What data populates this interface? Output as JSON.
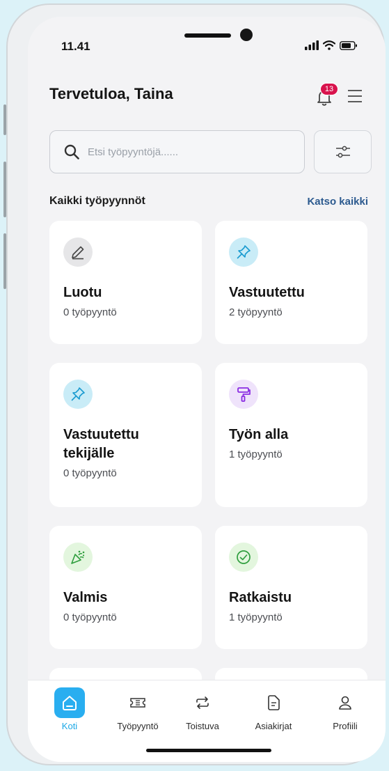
{
  "status_bar": {
    "time": "11.41"
  },
  "header": {
    "greeting": "Tervetuloa, Taina",
    "notification_count": "13"
  },
  "search": {
    "placeholder": "Etsi työpyyntöjä......"
  },
  "section": {
    "title": "Kaikki työpyynnöt",
    "link": "Katso kaikki"
  },
  "cards": [
    {
      "title": "Luotu",
      "count": "0 työpyyntö",
      "icon": "pencil-icon",
      "icon_bg": "#e6e6e8"
    },
    {
      "title": "Vastuutettu",
      "count": "2 työpyyntö",
      "icon": "pin-icon",
      "icon_bg": "#c9ecf7"
    },
    {
      "title": "Vastuutettu tekijälle",
      "count": "0 työpyyntö",
      "icon": "pin-icon",
      "icon_bg": "#c9ecf7"
    },
    {
      "title": "Työn alla",
      "count": "1 työpyyntö",
      "icon": "paint-roller-icon",
      "icon_bg": "#efe3fb"
    },
    {
      "title": "Valmis",
      "count": "0 työpyyntö",
      "icon": "party-popper-icon",
      "icon_bg": "#e3f6de"
    },
    {
      "title": "Ratkaistu",
      "count": "1 työpyyntö",
      "icon": "check-circle-icon",
      "icon_bg": "#e3f6de"
    }
  ],
  "nav": [
    {
      "label": "Koti",
      "icon": "home-icon",
      "active": true
    },
    {
      "label": "Työpyyntö",
      "icon": "ticket-icon"
    },
    {
      "label": "Toistuva",
      "icon": "repeat-icon"
    },
    {
      "label": "Asiakirjat",
      "icon": "document-icon"
    },
    {
      "label": "Profiili",
      "icon": "user-icon"
    }
  ],
  "colors": {
    "accent": "#29aef0",
    "badge": "#d8134d",
    "link": "#2c5a8f"
  }
}
